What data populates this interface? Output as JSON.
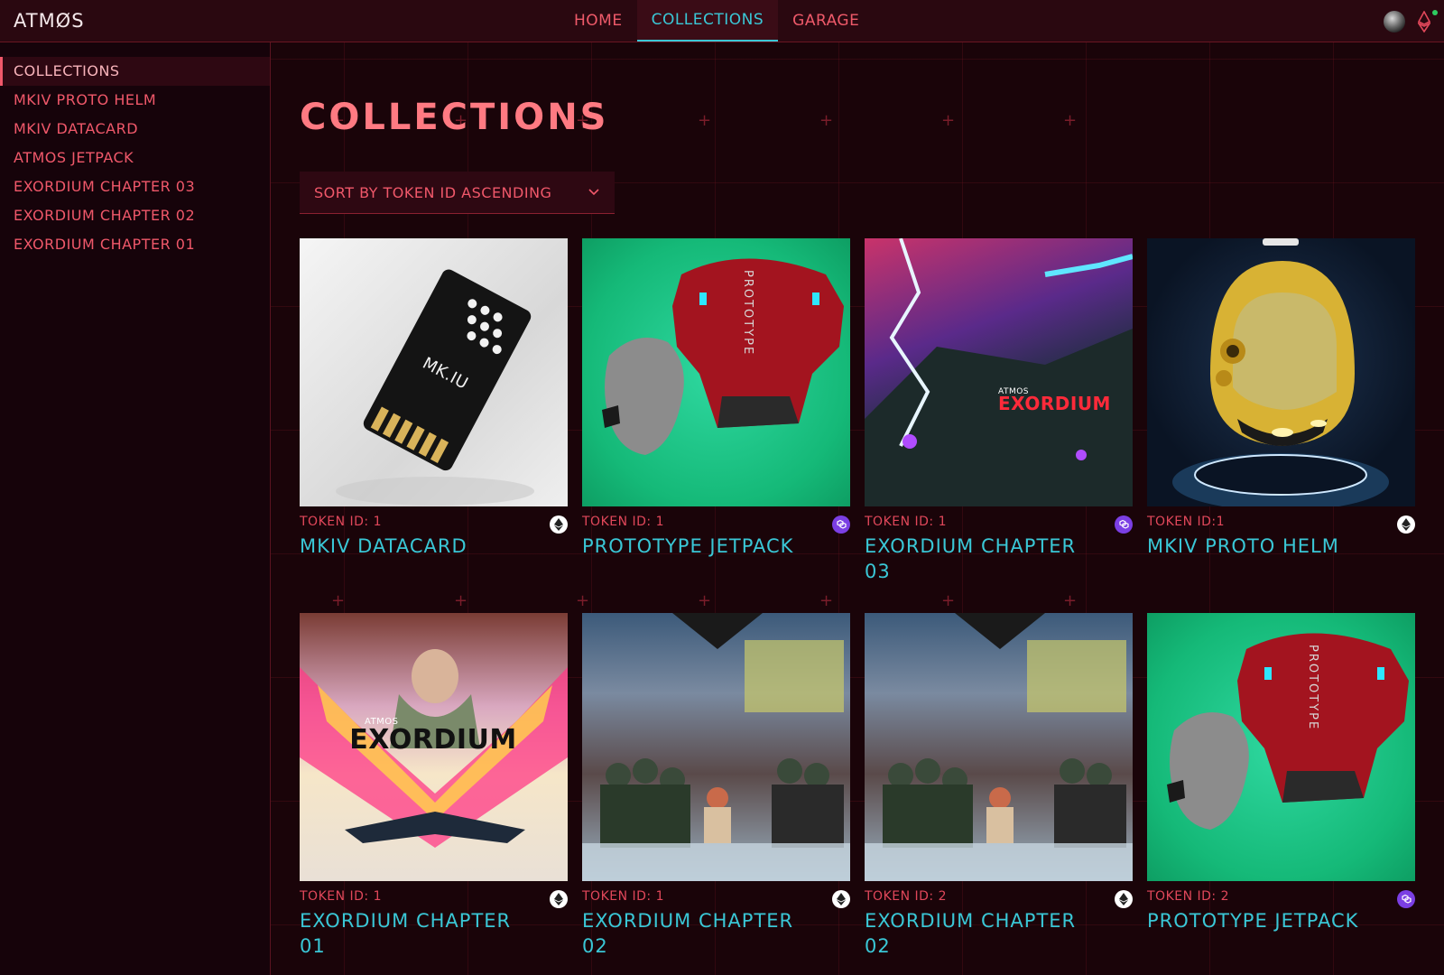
{
  "app": {
    "logo": "ATMØS"
  },
  "nav": {
    "items": [
      {
        "label": "HOME",
        "active": false
      },
      {
        "label": "COLLECTIONS",
        "active": true
      },
      {
        "label": "GARAGE",
        "active": false
      }
    ]
  },
  "sidebar": {
    "items": [
      {
        "label": "COLLECTIONS",
        "active": true
      },
      {
        "label": "MKIV PROTO HELM"
      },
      {
        "label": "MKIV DATACARD"
      },
      {
        "label": "ATMOS JETPACK"
      },
      {
        "label": "EXORDIUM CHAPTER 03"
      },
      {
        "label": "EXORDIUM CHAPTER 02"
      },
      {
        "label": "EXORDIUM CHAPTER 01"
      }
    ]
  },
  "main": {
    "title": "COLLECTIONS",
    "sort_label": "SORT BY TOKEN ID ASCENDING",
    "cards": [
      {
        "token": "TOKEN ID: 1",
        "name": "MKIV DATACARD",
        "chain": "ethereum",
        "art": "datacard"
      },
      {
        "token": "TOKEN ID: 1",
        "name": "PROTOTYPE JETPACK",
        "chain": "polygon",
        "art": "jetpack"
      },
      {
        "token": "TOKEN ID: 1",
        "name": "EXORDIUM CHAPTER 03",
        "chain": "polygon",
        "art": "exordium3",
        "art_text": "EXORDIUM",
        "art_brand": "ATMOS"
      },
      {
        "token": "TOKEN ID:1",
        "name": "MKIV PROTO HELM",
        "chain": "ethereum",
        "art": "helm"
      },
      {
        "token": "TOKEN ID: 1",
        "name": "EXORDIUM CHAPTER 01",
        "chain": "ethereum",
        "art": "exordium1",
        "art_text": "EXORDIUM",
        "art_brand": "ATMOS"
      },
      {
        "token": "TOKEN ID: 1",
        "name": "EXORDIUM CHAPTER 02",
        "chain": "ethereum",
        "art": "exordium2"
      },
      {
        "token": "TOKEN ID: 2",
        "name": "EXORDIUM CHAPTER 02",
        "chain": "ethereum",
        "art": "exordium2"
      },
      {
        "token": "TOKEN ID: 2",
        "name": "PROTOTYPE JETPACK",
        "chain": "polygon",
        "art": "jetpack"
      }
    ],
    "art_labels": {
      "datacard": "MK.IU",
      "jetpack": "PROTOTYPE"
    }
  },
  "colors": {
    "accent_pink": "#f0586a",
    "accent_cyan": "#3ac7d6",
    "background": "#1a0409",
    "ethereum": "#ffffff",
    "polygon": "#7b3fe4"
  },
  "icons": {
    "chain_ethereum": "ethereum-icon",
    "chain_polygon": "polygon-icon",
    "sort": "chevron-down-icon",
    "user": "avatar",
    "wallet": "ethereum-icon"
  }
}
